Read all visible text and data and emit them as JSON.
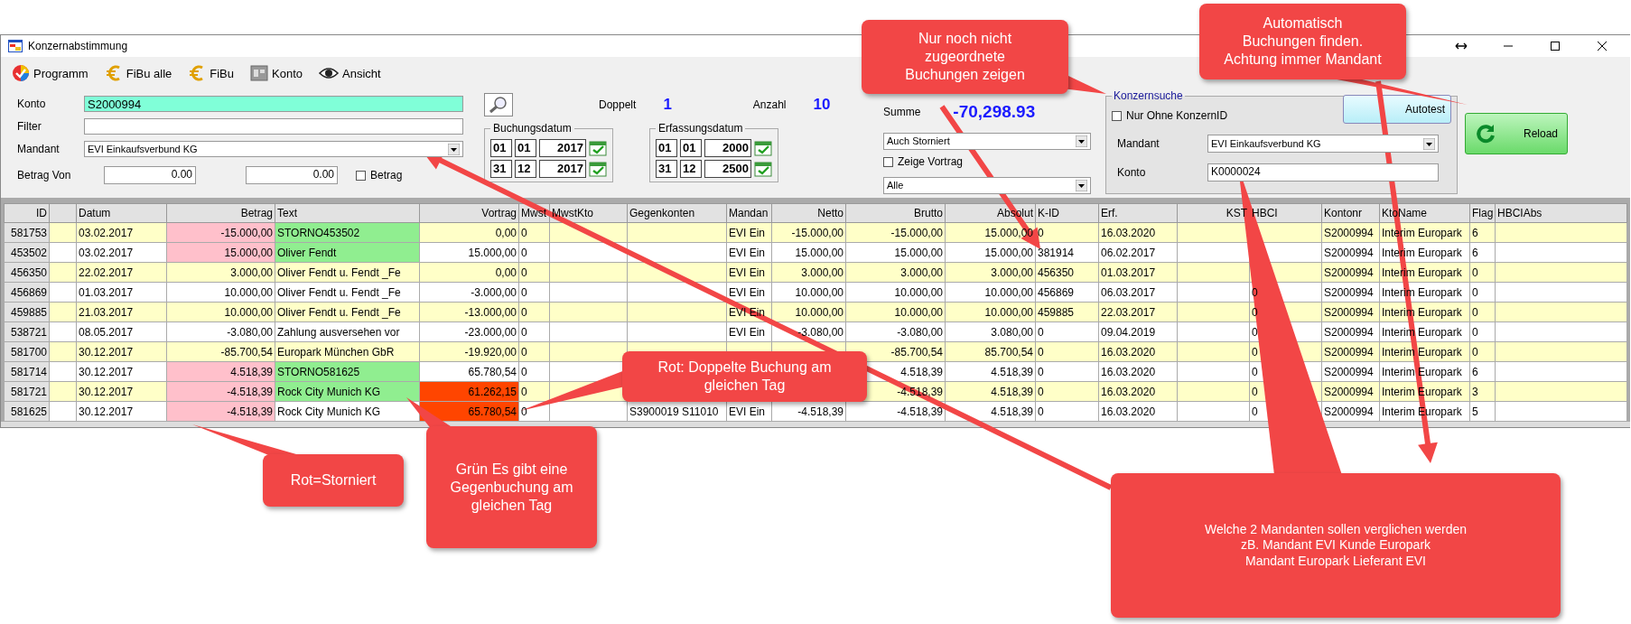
{
  "window": {
    "title": "Konzernabstimmung"
  },
  "toolbar": [
    {
      "label": "Programm",
      "kind": "ball"
    },
    {
      "label": "FiBu alle",
      "kind": "euro"
    },
    {
      "label": "FiBu",
      "kind": "euro"
    },
    {
      "label": "Konto",
      "kind": "cards"
    },
    {
      "label": "Ansicht",
      "kind": "eye"
    }
  ],
  "filter_panel": {
    "konto": {
      "label": "Konto",
      "value": "S2000994"
    },
    "filter": {
      "label": "Filter"
    },
    "mandant": {
      "label": "Mandant",
      "value": "EVI Einkaufsverbund KG"
    },
    "betrag_von": {
      "label": "Betrag Von",
      "value": "0.00"
    },
    "betrag_bis": {
      "value": "0.00"
    },
    "betrag_checkbox": {
      "label": "Betrag",
      "checked": false
    }
  },
  "stats": {
    "doppelt": {
      "label": "Doppelt",
      "value": "1"
    },
    "anzahl": {
      "label": "Anzahl",
      "value": "10"
    },
    "summe": {
      "label": "Summe",
      "value": "-70,298.93"
    }
  },
  "buchungsdatum": {
    "label": "Buchungsdatum",
    "rows": [
      [
        "01",
        "01",
        "2017"
      ],
      [
        "31",
        "12",
        "2017"
      ]
    ]
  },
  "erfassungsdatum": {
    "label": "Erfassungsdatum",
    "rows": [
      [
        "01",
        "01",
        "2000"
      ],
      [
        "31",
        "12",
        "2500"
      ]
    ]
  },
  "storno_dropdown": {
    "value": "Auch Storniert"
  },
  "zeige_vortrag": {
    "label": "Zeige Vortrag",
    "checked": false
  },
  "filter_dropdown": {
    "value": "Alle"
  },
  "konzernsuche": {
    "title": "Konzernsuche",
    "nur_ohne": {
      "label": "Nur Ohne KonzernID",
      "checked": false
    },
    "mandant": {
      "label": "Mandant",
      "value": "EVI Einkaufsverbund KG"
    },
    "konto": {
      "label": "Konto",
      "value": "K0000024"
    },
    "autotest_button": "Autotest"
  },
  "reload_button": "Reload",
  "table": {
    "columns": [
      "ID",
      null,
      "Datum",
      "Betrag",
      "Text",
      "Vortrag",
      "Mwst",
      "MwstKto",
      "Gegenkonten",
      "Mandan",
      "Netto",
      "Brutto",
      "Absolut",
      "K-ID",
      "Erf.",
      "KST",
      "HBCI",
      "Kontonr",
      "KtoName",
      "Flag",
      "HBCIAbs"
    ],
    "rows": [
      {
        "cells": [
          "581753",
          null,
          "03.02.2017",
          "-15.000,00",
          "STORNO453502",
          "0,00",
          "0",
          null,
          null,
          "EVI Ein",
          "-15.000,00",
          "-15.000,00",
          "15.000,00",
          "0",
          "16.03.2020",
          null,
          null,
          "S2000994",
          "Interim Europark",
          "6",
          null
        ],
        "storniert": true,
        "gegenbuchung": true,
        "doppelt": false
      },
      {
        "cells": [
          "453502",
          null,
          "03.02.2017",
          "15.000,00",
          "Oliver Fendt",
          "15.000,00",
          "0",
          null,
          null,
          "EVI Ein",
          "15.000,00",
          "15.000,00",
          "15.000,00",
          "381914",
          "06.02.2017",
          null,
          null,
          "S2000994",
          "Interim Europark",
          "6",
          null
        ],
        "storniert": true,
        "gegenbuchung": true,
        "doppelt": false
      },
      {
        "cells": [
          "456350",
          null,
          "22.02.2017",
          "3.000,00",
          "Oliver Fendt u. Fendt _Fe",
          "0,00",
          "0",
          null,
          null,
          "EVI Ein",
          "3.000,00",
          "3.000,00",
          "3.000,00",
          "456350",
          "01.03.2017",
          null,
          null,
          "S2000994",
          "Interim Europark",
          "0",
          null
        ],
        "storniert": false,
        "gegenbuchung": false,
        "doppelt": false
      },
      {
        "cells": [
          "456869",
          null,
          "01.03.2017",
          "10.000,00",
          "Oliver Fendt u. Fendt _Fe",
          "-3.000,00",
          "0",
          null,
          null,
          "EVI Ein",
          "10.000,00",
          "10.000,00",
          "10.000,00",
          "456869",
          "06.03.2017",
          null,
          "0",
          "S2000994",
          "Interim Europark",
          "0",
          null
        ],
        "storniert": false,
        "gegenbuchung": false,
        "doppelt": false
      },
      {
        "cells": [
          "459885",
          null,
          "21.03.2017",
          "10.000,00",
          "Oliver Fendt u. Fendt _Fe",
          "-13.000,00",
          "0",
          null,
          null,
          "EVI Ein",
          "10.000,00",
          "10.000,00",
          "10.000,00",
          "459885",
          "22.03.2017",
          null,
          "0",
          "S2000994",
          "Interim Europark",
          "0",
          null
        ],
        "storniert": false,
        "gegenbuchung": false,
        "doppelt": false
      },
      {
        "cells": [
          "538721",
          null,
          "08.05.2017",
          "-3.080,00",
          "Zahlung ausversehen vor",
          "-23.000,00",
          "0",
          null,
          null,
          "EVI Ein",
          "-3.080,00",
          "-3.080,00",
          "3.080,00",
          "0",
          "09.04.2019",
          null,
          "0",
          "S2000994",
          "Interim Europark",
          "0",
          null
        ],
        "storniert": false,
        "gegenbuchung": false,
        "doppelt": false
      },
      {
        "cells": [
          "581700",
          null,
          "30.12.2017",
          "-85.700,54",
          "Europark München GbR",
          "-19.920,00",
          "0",
          null,
          null,
          null,
          null,
          "-85.700,54",
          "85.700,54",
          "0",
          "16.03.2020",
          null,
          "0",
          "S2000994",
          "Interim Europark",
          "0",
          null
        ],
        "storniert": false,
        "gegenbuchung": false,
        "doppelt": false
      },
      {
        "cells": [
          "581714",
          null,
          "30.12.2017",
          "4.518,39",
          "STORNO581625",
          "65.780,54",
          "0",
          null,
          null,
          null,
          null,
          "4.518,39",
          "4.518,39",
          "0",
          "16.03.2020",
          null,
          "0",
          "S2000994",
          "Interim Europark",
          "6",
          null
        ],
        "storniert": true,
        "gegenbuchung": true,
        "doppelt": false
      },
      {
        "cells": [
          "581721",
          null,
          "30.12.2017",
          "-4.518,39",
          "Rock City Munich KG",
          "61.262,15",
          "0",
          null,
          null,
          null,
          null,
          "-4.518,39",
          "4.518,39",
          "0",
          "16.03.2020",
          null,
          "0",
          "S2000994",
          "Interim Europark",
          "3",
          null
        ],
        "storniert": true,
        "gegenbuchung": true,
        "doppelt": true
      },
      {
        "cells": [
          "581625",
          null,
          "30.12.2017",
          "-4.518,39",
          "Rock City Munich KG",
          "65.780,54",
          "0",
          null,
          "S3900019 S11010",
          "EVI Ein",
          "-4.518,39",
          "-4.518,39",
          "4.518,39",
          "0",
          "16.03.2020",
          null,
          "0",
          "S2000994",
          "Interim Europark",
          "5",
          null
        ],
        "storniert": true,
        "gegenbuchung": false,
        "doppelt": true
      }
    ]
  },
  "annotations": [
    {
      "text": "Automatisch\nBuchungen finden.\nAchtung immer Mandant"
    },
    {
      "text": "Nur noch nicht\nzugeordnete\nBuchungen zeigen"
    },
    {
      "text": "Rot: Doppelte Buchung am\ngleichen Tag"
    },
    {
      "text": "Grün Es gibt eine\nGegenbuchung am\ngleichen Tag"
    },
    {
      "text": "Rot=Storniert"
    },
    {
      "text": "Welche 2 Mandanten sollen verglichen werden\nzB. Mandant EVI Kunde Europark\nMandant Europark Lieferant EVI"
    }
  ]
}
